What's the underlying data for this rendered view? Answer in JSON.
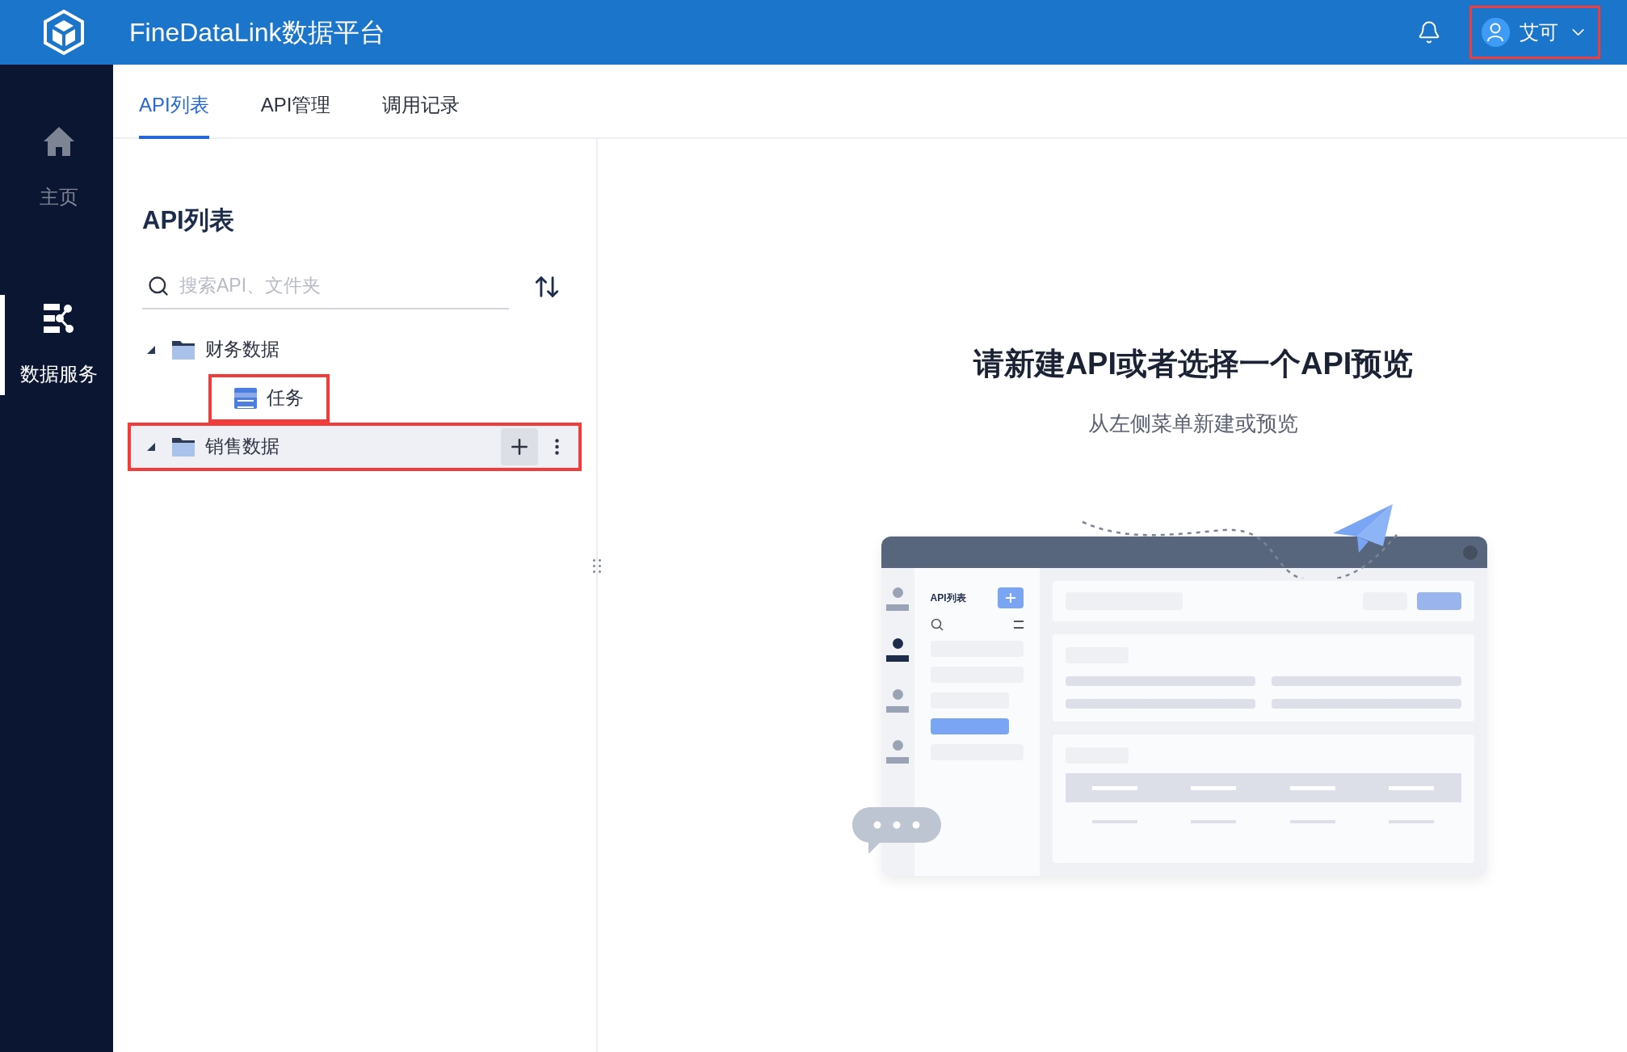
{
  "header": {
    "title": "FineDataLink数据平台",
    "user": {
      "name": "艾可",
      "highlighted": true
    }
  },
  "sidebar": {
    "items": [
      {
        "label": "主页",
        "kind": "home",
        "selected": false
      },
      {
        "label": "数据服务",
        "kind": "service",
        "selected": true
      }
    ]
  },
  "tabs": [
    {
      "label": "API列表",
      "selected": true
    },
    {
      "label": "API管理",
      "selected": false
    },
    {
      "label": "调用记录",
      "selected": false
    }
  ],
  "panel": {
    "title": "API列表",
    "search": {
      "placeholder": "搜索API、文件夹"
    },
    "tree": [
      {
        "label": "财务数据",
        "kind": "folder",
        "expanded": true,
        "hovered": false,
        "highlighted": false,
        "children": [
          {
            "label": "任务",
            "kind": "api",
            "hovered": false,
            "highlighted": true
          }
        ]
      },
      {
        "label": "销售数据",
        "kind": "folder",
        "expanded": true,
        "hovered": true,
        "highlighted": true
      }
    ]
  },
  "empty_state": {
    "title": "请新建API或者选择一个API预览",
    "subtitle": "从左侧菜单新建或预览",
    "illustration": {
      "label": "API列表"
    }
  }
}
